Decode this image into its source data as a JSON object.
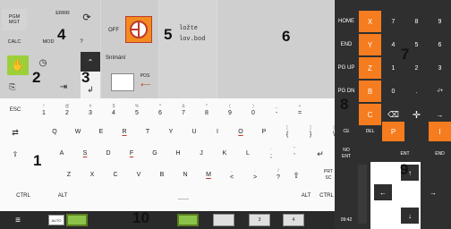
{
  "top_controls": {
    "pgm_mgt": [
      "PGM",
      "MGT"
    ],
    "errr": "ERRR",
    "calc": "CALC",
    "mod": "MOD",
    "help_arrow": "?",
    "off_label": "OFF",
    "set_point_text": [
      "ložte",
      "lov.bod"
    ],
    "snimani": "Snímání",
    "pos": "POS"
  },
  "right_nav_keys": [
    "HOME",
    "END",
    "PG UP",
    "PG DN"
  ],
  "axis_keys": [
    "X",
    "Y",
    "Z",
    "B",
    "C"
  ],
  "numpad": [
    [
      "7",
      "8",
      "9"
    ],
    [
      "4",
      "5",
      "6"
    ],
    [
      "1",
      "2",
      "3"
    ],
    [
      "0",
      ".",
      "-/+"
    ]
  ],
  "ops": {
    "ce": "CE",
    "del": [
      "DEL"
    ],
    "enter_block": [
      "NO",
      "ENT"
    ],
    "ent": "ENT",
    "end": [
      "END"
    ]
  },
  "p_key": "P",
  "i_key": "I",
  "number_row": [
    {
      "sym": "!",
      "main": "1"
    },
    {
      "sym": "@",
      "main": "2"
    },
    {
      "sym": "#",
      "main": "3"
    },
    {
      "sym": "$",
      "main": "4"
    },
    {
      "sym": "%",
      "main": "5"
    },
    {
      "sym": "^",
      "main": "6"
    },
    {
      "sym": "&",
      "main": "7"
    },
    {
      "sym": "*",
      "main": "8"
    },
    {
      "sym": "(",
      "main": "9"
    },
    {
      "sym": ")",
      "main": "0"
    },
    {
      "sym": "_",
      "main": "-"
    },
    {
      "sym": "+",
      "main": "="
    }
  ],
  "row_q": [
    "Q",
    "W",
    "E",
    "R",
    "T",
    "Y",
    "U",
    "I",
    "O",
    "P",
    "{",
    "}",
    "\\"
  ],
  "row_q_sym": [
    "",
    "",
    "",
    "",
    "",
    "",
    "",
    "",
    "",
    "",
    "[",
    "]",
    "|"
  ],
  "row_a": [
    "A",
    "S",
    "D",
    "F",
    "G",
    "H",
    "J",
    "K",
    "L",
    ";",
    "'"
  ],
  "row_a_sym": [
    "",
    "",
    "",
    "",
    "",
    "",
    "",
    "",
    "",
    ":",
    "\""
  ],
  "row_z": [
    "Z",
    "X",
    "C",
    "V",
    "B",
    "N",
    "M",
    "<",
    ">",
    "?"
  ],
  "row_z_sub": [
    "",
    "",
    "",
    "",
    "",
    "",
    "",
    ",",
    ".",
    "/"
  ],
  "esc": "ESC",
  "tab": "⇄",
  "caps": "⇧",
  "shift": "⇧",
  "enter": "↵",
  "ctrl_left": "CTRL",
  "alt_left": "ALT",
  "space": "___",
  "alt_right": "ALT",
  "ctrl_right": "CTRL",
  "prtsc": [
    "PRT",
    "SC"
  ],
  "taskbar": {
    "menu": "≡",
    "auto": "AUTO",
    "pages": [
      "3",
      "4"
    ],
    "time": "09:42"
  },
  "callouts": [
    "1",
    "2",
    "3",
    "4",
    "5",
    "6",
    "7",
    "8",
    "9",
    "10"
  ]
}
